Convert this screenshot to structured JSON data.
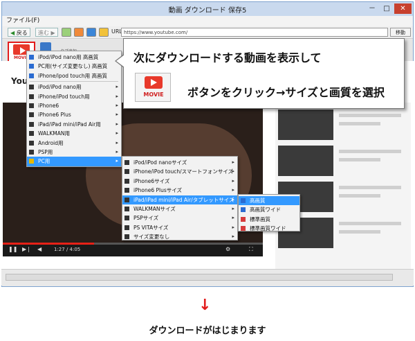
{
  "window": {
    "title": "動画 ダウンロード 保存5",
    "minimize": "－",
    "maximize": "□",
    "close": "✕"
  },
  "menubar": {
    "file": "ファイル(F)"
  },
  "toolbar": {
    "back": "戻る",
    "forward": "進む",
    "url_label": "URL",
    "url_value": "https://www.youtube.com/",
    "go": "移動"
  },
  "tabs": {
    "movie_label": "MOVIE",
    "tab2": "タブ追加"
  },
  "youtube": {
    "time": "1:27 / 4:05",
    "progress": 0.35
  },
  "menu1": {
    "items": [
      {
        "label": "iPod/iPod nano用 高画質",
        "submenu": false
      },
      {
        "label": "PC用(サイズ変更なし) 高画質",
        "submenu": false
      },
      {
        "label": "iPhone/ipod touch用 高画質",
        "submenu": false
      },
      {
        "label": "iPod/iPod nano用",
        "submenu": true
      },
      {
        "label": "iPhone/iPod touch用",
        "submenu": true
      },
      {
        "label": "iPhone6",
        "submenu": true
      },
      {
        "label": "iPhone6 Plus",
        "submenu": true
      },
      {
        "label": "iPad/iPad mini/iPad Air用",
        "submenu": true
      },
      {
        "label": "WALKMAN用",
        "submenu": true
      },
      {
        "label": "Android用",
        "submenu": true
      },
      {
        "label": "PSP用",
        "submenu": true
      },
      {
        "label": "PC用",
        "submenu": true
      }
    ]
  },
  "menu2": {
    "items": [
      {
        "label": "iPod/iPod nanoサイズ",
        "submenu": true
      },
      {
        "label": "iPhone/iPod touch/スマートフォンサイズ",
        "submenu": true
      },
      {
        "label": "iPhone6サイズ",
        "submenu": true
      },
      {
        "label": "iPhone6 Plusサイズ",
        "submenu": true
      },
      {
        "label": "iPad/iPad mini/iPad Air/タブレットサイズ",
        "submenu": true
      },
      {
        "label": "WALKMANサイズ",
        "submenu": true
      },
      {
        "label": "PSPサイズ",
        "submenu": true
      },
      {
        "label": "PS VITAサイズ",
        "submenu": true
      },
      {
        "label": "サイズ変更なし",
        "submenu": true
      }
    ]
  },
  "menu3": {
    "items": [
      {
        "label": "高画質"
      },
      {
        "label": "高画質ワイド"
      },
      {
        "label": "標準画質"
      },
      {
        "label": "標準画質ワイド"
      }
    ]
  },
  "callout": {
    "line1": "次にダウンロードする動画を表示して",
    "line2": "ボタンをクリック→サイズと画質を選択",
    "movie_label": "MOVIE"
  },
  "footer": {
    "arrow": "↓",
    "text": "ダウンロードがはじまります"
  },
  "colors": {
    "accent_red": "#e21b1b",
    "menu_highlight": "#3399ff",
    "youtube_red": "#e62117"
  }
}
